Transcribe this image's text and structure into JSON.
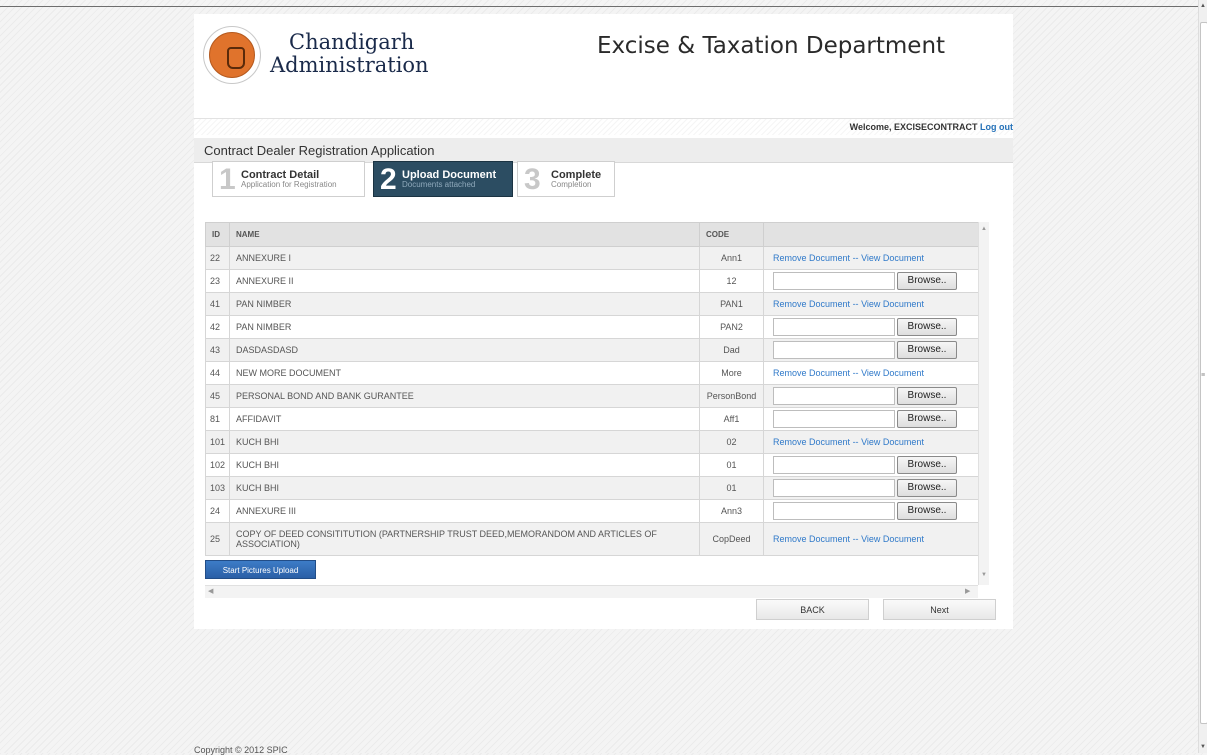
{
  "header": {
    "admin_line1": "Chandigarh",
    "admin_line2": "Administration",
    "department": "Excise & Taxation Department",
    "logo_icon": "chandigarh-open-hand-seal"
  },
  "welcome": {
    "text": "Welcome, EXCISECONTRACT",
    "logout": "Log out"
  },
  "form_title": "Contract Dealer Registration Application",
  "steps": [
    {
      "number": "1",
      "title": "Contract Detail",
      "subtitle": "Application for Registration",
      "active": false
    },
    {
      "number": "2",
      "title": "Upload Document",
      "subtitle": "Documents attached",
      "active": true
    },
    {
      "number": "3",
      "title": "Complete",
      "subtitle": "Completion",
      "active": false
    }
  ],
  "grid": {
    "columns": [
      "ID",
      "NAME",
      "CODE",
      ""
    ],
    "remove_label": "Remove Document",
    "separator": "--",
    "view_label": "View Document",
    "browse_label": "Browse..",
    "rows": [
      {
        "id": "22",
        "name": "ANNEXURE I",
        "code": "Ann1",
        "action": "links"
      },
      {
        "id": "23",
        "name": "ANNEXURE II",
        "code": "12",
        "action": "upload"
      },
      {
        "id": "41",
        "name": "PAN NIMBER",
        "code": "PAN1",
        "action": "links"
      },
      {
        "id": "42",
        "name": "PAN NIMBER",
        "code": "PAN2",
        "action": "upload"
      },
      {
        "id": "43",
        "name": "DASDASDASD",
        "code": "Dad",
        "action": "upload"
      },
      {
        "id": "44",
        "name": "NEW MORE DOCUMENT",
        "code": "More",
        "action": "links"
      },
      {
        "id": "45",
        "name": "PERSONAL BOND AND BANK GURANTEE",
        "code": "PersonBond",
        "action": "upload"
      },
      {
        "id": "81",
        "name": "AFFIDAVIT",
        "code": "Aff1",
        "action": "upload"
      },
      {
        "id": "101",
        "name": "KUCH BHI",
        "code": "02",
        "action": "links"
      },
      {
        "id": "102",
        "name": "KUCH BHI",
        "code": "01",
        "action": "upload"
      },
      {
        "id": "103",
        "name": "KUCH BHI",
        "code": "01",
        "action": "upload"
      },
      {
        "id": "24",
        "name": "ANNEXURE III",
        "code": "Ann3",
        "action": "upload"
      },
      {
        "id": "25",
        "name": "COPY OF DEED CONSITITUTION (PARTNERSHIP TRUST DEED,MEMORANDOM AND ARTICLES OF ASSOCIATION)",
        "code": "CopDeed",
        "action": "links"
      }
    ]
  },
  "start_upload": "Start Pictures Upload",
  "buttons": {
    "back": "BACK",
    "next": "Next"
  },
  "footer": "Copyright © 2012 SPIC"
}
